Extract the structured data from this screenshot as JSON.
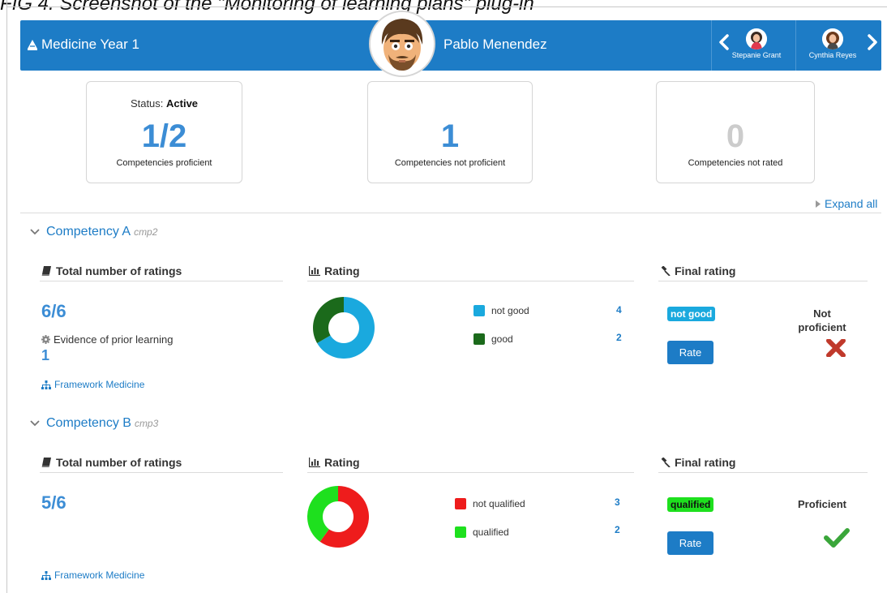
{
  "caption": "FIG 4. Screenshot of the \"Monitoring of learning plans\" plug-in",
  "colors": {
    "primary": "#1d7cc6",
    "not_good": "#1aa9de",
    "good": "#1b6a1b",
    "not_qualified": "#ee1c1c",
    "qualified": "#1ee01e",
    "not_rated": "#cccccc"
  },
  "header": {
    "plan_title": "Medicine Year 1",
    "user_name": "Pablo Menendez",
    "prev_user": "Stepanie Grant",
    "next_user": "Cynthia Reyes"
  },
  "stats": {
    "status_label": "Status: ",
    "status_value": "Active",
    "proficient_value": "1/2",
    "proficient_label": "Competencies proficient",
    "not_proficient_value": "1",
    "not_proficient_label": "Competencies not proficient",
    "not_rated_value": "0",
    "not_rated_label": "Competencies not rated"
  },
  "expand_all": "Expand all",
  "competencies": [
    {
      "title": "Competency A",
      "code": "cmp2",
      "total_ratings_heading": "Total number of ratings",
      "ratings_ratio": "6/6",
      "evidence_label": "Evidence of prior learning",
      "evidence_count": "1",
      "framework_link": "Framework Medicine",
      "rating_heading": "Rating",
      "final_rating_heading": "Final rating",
      "legend": [
        {
          "label": "not good",
          "count": "4"
        },
        {
          "label": "good",
          "count": "2"
        }
      ],
      "final_badge": "not good",
      "rate_button": "Rate",
      "proficiency": "Not proficient",
      "proficiency_icon": "cross-icon"
    },
    {
      "title": "Competency B",
      "code": "cmp3",
      "total_ratings_heading": "Total number of ratings",
      "ratings_ratio": "5/6",
      "framework_link": "Framework Medicine",
      "rating_heading": "Rating",
      "final_rating_heading": "Final rating",
      "legend": [
        {
          "label": "not qualified",
          "count": "3"
        },
        {
          "label": "qualified",
          "count": "2"
        }
      ],
      "final_badge": "qualified",
      "rate_button": "Rate",
      "proficiency": "Proficient",
      "proficiency_icon": "checkmark-icon"
    }
  ],
  "chart_data": [
    {
      "type": "pie",
      "categories": [
        "not good",
        "good"
      ],
      "values": [
        4,
        2
      ],
      "colors": [
        "#1aa9de",
        "#1b6a1b"
      ]
    },
    {
      "type": "pie",
      "categories": [
        "not qualified",
        "qualified"
      ],
      "values": [
        3,
        2
      ],
      "colors": [
        "#ee1c1c",
        "#1ee01e"
      ]
    }
  ]
}
